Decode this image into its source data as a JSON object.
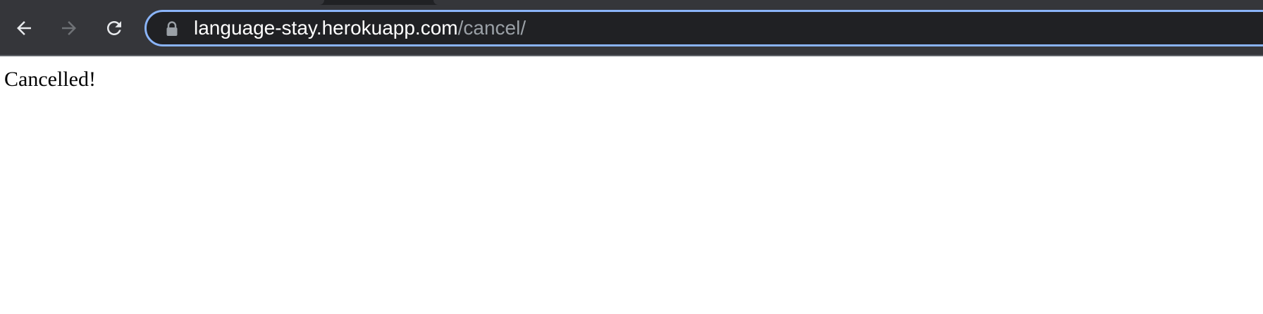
{
  "browser": {
    "toolbar": {
      "back_icon": "arrow-left-icon",
      "forward_icon": "arrow-right-icon",
      "reload_icon": "reload-icon",
      "forward_enabled": false
    },
    "address_bar": {
      "lock_icon": "lock-icon",
      "url_host": "language-stay.herokuapp.com",
      "url_path": "/cancel/",
      "focused": true,
      "focus_ring_color": "#8ab4f8"
    },
    "colors": {
      "toolbar_bg": "#35363a",
      "omnibox_bg": "#202124",
      "icon_active": "#e8eaed",
      "icon_disabled": "#6f7276"
    }
  },
  "page": {
    "message": "Cancelled!"
  }
}
